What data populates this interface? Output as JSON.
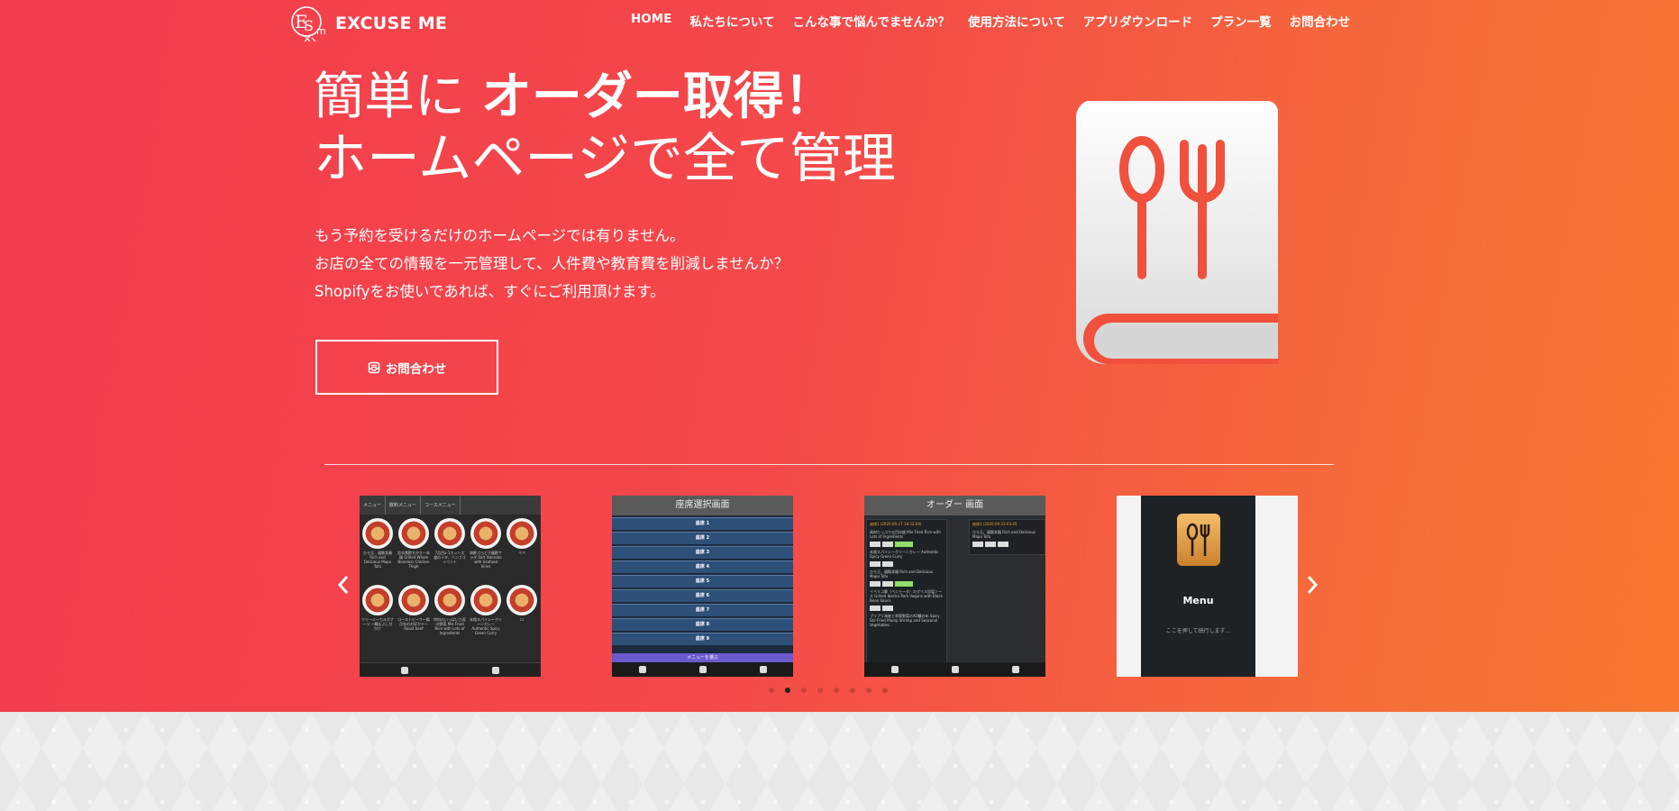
{
  "header": {
    "logo_text": "EXCUSE ME",
    "nav": [
      "HOME",
      "私たちについて",
      "こんな事で悩んでませんか？",
      "使用方法について",
      "アプリダウンロード",
      "プラン一覧",
      "お問合わせ"
    ]
  },
  "hero": {
    "title_light": "簡単に ",
    "title_bold": "オーダー取得！",
    "title_line2": "ホームページで全て管理",
    "description": [
      "もう予約を受けるだけのホームページでは有りません。",
      "お店の全ての情報を一元管理して、人件費や教育費を削減しませんか？",
      "Shopifyをお使いであれば、すぐにご利用頂けます。"
    ],
    "cta_label": "お問合わせ",
    "icon": "menu-book-icon"
  },
  "carousel": {
    "prev_icon": "chevron-left-icon",
    "next_icon": "chevron-right-icon",
    "slide1": {
      "tabs": [
        "メニュー",
        "飲料メニュー",
        "コースメニュー"
      ],
      "items": [
        "ひろ玉、親豚丼麺 Rich and Delicious Mapo Tofu",
        "旨辛黒酢ちかり一本鶏 Grilled Whole Boneless Chicken Thigh",
        "7品目a 1カット大盛のイタ、ハンブゴイベント",
        "海鮮ぷらどり麺酢サラダ Salt Yakisoba with Seafood Vines",
        "ペペ",
        "海鮮",
        "クリーミーカルボナーラ ～鯛まぶし付かけ",
        "ローストビーフ～霜月年のお好かテー Roast beef",
        "特別のいっぱいカ家の野菜 Mie Fried Rice with Lots of Ingredients",
        "本格スパイシーグリーンカレー Authentic Spicy Green Curry",
        "ロ"
      ]
    },
    "slide2": {
      "header": "座席選択画面",
      "seats": [
        "座席 1",
        "座席 2",
        "座席 3",
        "座席 4",
        "座席 5",
        "座席 6",
        "座席 7",
        "座席 8",
        "座席 9"
      ],
      "select_label": "メニューを選ぶ"
    },
    "slide3": {
      "header": "オーダー 画面",
      "card1_title": "座席1 (2020-09-27 18:32:04)",
      "card1_lines": [
        "具材たっぷり五目炒飯 Mie Fried Rice with Lots of Ingredients",
        "本格スパイシーグリーンカレー Authentic Spicy Green Curry",
        "ひろ玉、親豚丼麺 Rich and Delicious Mapo Tofu",
        "イベリコ豚（ベジョータ）のグリル旨塩ソース Grilled Iberico Pork Vegons with Black Bean Sauce",
        "プリプリ海老と季節野菜のXO醬炒め Spicy Stir-Fried Plump Shrimp and Seasonal Vegetables"
      ],
      "card2_title": "座席3 (2020-09-23 03:45",
      "card2_line": "ひろ玉、親豚丼麺 Rich and Delicious Mapo Tofu",
      "qty": "1/1"
    },
    "slide4": {
      "app_name": "Menu",
      "tip": "ここを押して続行します..."
    },
    "dots_count": 8,
    "active_dot": 1
  }
}
